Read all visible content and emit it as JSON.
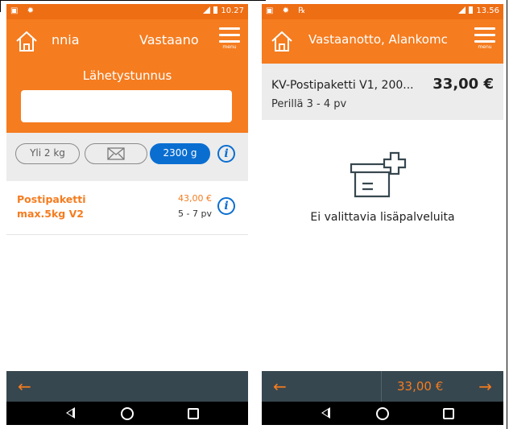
{
  "colors": {
    "brand_orange": "#f57c1f",
    "accent_blue": "#0a6ed1",
    "bottom_bar": "#37474f",
    "nav_bar": "#000000"
  },
  "screen1": {
    "statusbar": {
      "left_icons": "▣ ✹",
      "time": "10.27"
    },
    "appbar": {
      "title_left": "nnia",
      "title_right": "Vastaano",
      "menu_label": "menu",
      "home_icon": "home-icon"
    },
    "tracking": {
      "label": "Lähetystunnus",
      "value": "",
      "placeholder": ""
    },
    "filters": [
      {
        "label": "Yli 2 kg",
        "selected": false
      },
      {
        "label": "",
        "icon": "envelope-icon",
        "selected": false
      },
      {
        "label": "2300 g",
        "selected": true
      }
    ],
    "products": [
      {
        "name": "Postipaketti max.5kg V2",
        "price": "43,00 €",
        "delivery": "5 - 7 pv"
      }
    ]
  },
  "screen2": {
    "statusbar": {
      "left_icons": "▣ ✹ ℞",
      "time": "13.56"
    },
    "appbar": {
      "title": "Vastaanotto, Alankomc",
      "menu_label": "menu",
      "home_icon": "home-icon"
    },
    "header": {
      "product_name": "KV-Postipaketti V1, 200...",
      "price": "33,00 €",
      "delivery": "Perillä 3 - 4 pv"
    },
    "empty_state": {
      "icon": "add-service-icon",
      "text": "Ei valittavia lisäpalveluita"
    },
    "bottom": {
      "total": "33,00 €"
    }
  }
}
